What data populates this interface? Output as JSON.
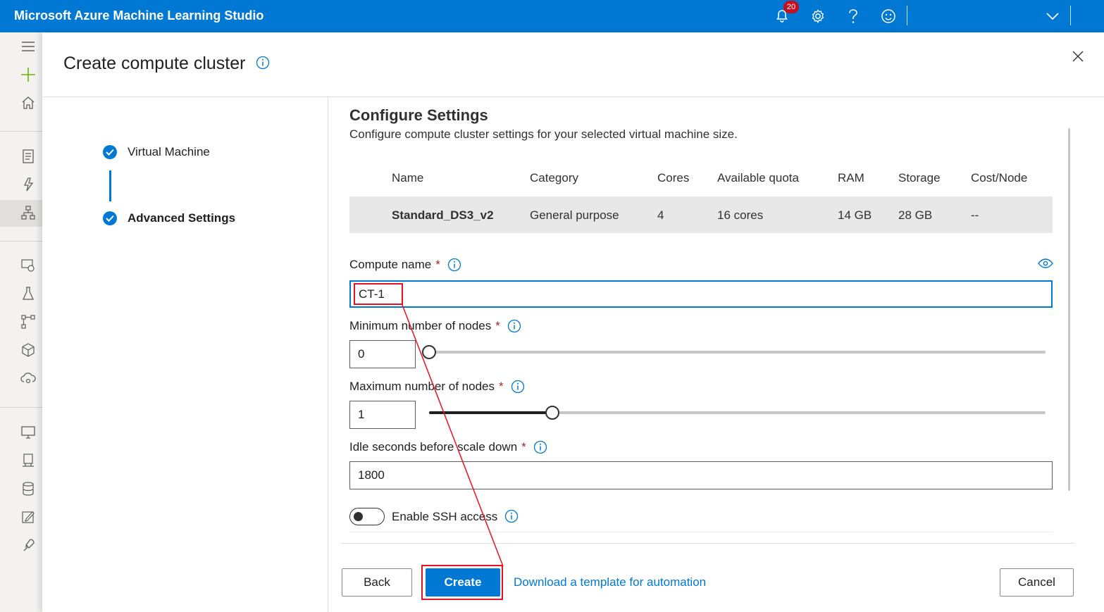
{
  "app": {
    "title": "Microsoft Azure Machine Learning Studio",
    "notification_count": "20"
  },
  "colors": {
    "brand": "#0078d4",
    "annotation": "#e81123"
  },
  "topbar_icons": [
    "bell-icon",
    "gear-icon",
    "help-icon",
    "smiley-icon",
    "chevron-down-icon"
  ],
  "leftnav_icons": [
    "hamburger-icon",
    "plus-icon",
    "home-icon",
    "notebook-icon",
    "automl-icon",
    "designer-icon",
    "datasets-icon",
    "experiments-icon",
    "pipelines-icon",
    "models-icon",
    "endpoints-icon",
    "compute-icon",
    "environments-icon",
    "datastores-icon",
    "labeling-icon",
    "linked-services-icon"
  ],
  "panel": {
    "title": "Create compute cluster"
  },
  "steps": [
    {
      "label": "Virtual Machine"
    },
    {
      "label": "Advanced Settings"
    }
  ],
  "section": {
    "title": "Configure Settings",
    "subtitle": "Configure compute cluster settings for your selected virtual machine size."
  },
  "vm_table": {
    "headers": [
      "Name",
      "Category",
      "Cores",
      "Available quota",
      "RAM",
      "Storage",
      "Cost/Node"
    ],
    "row": [
      "Standard_DS3_v2",
      "General purpose",
      "4",
      "16 cores",
      "14 GB",
      "28 GB",
      "--"
    ]
  },
  "fields": {
    "compute_name": {
      "label": "Compute name",
      "value": "CT-1"
    },
    "min_nodes": {
      "label": "Minimum number of nodes",
      "value": "0",
      "slider_fraction": 0.0
    },
    "max_nodes": {
      "label": "Maximum number of nodes",
      "value": "1",
      "slider_fraction": 0.2
    },
    "idle_seconds": {
      "label": "Idle seconds before scale down",
      "value": "1800"
    },
    "ssh": {
      "label": "Enable SSH access",
      "enabled": false
    }
  },
  "footer": {
    "back_label": "Back",
    "create_label": "Create",
    "template_link": "Download a template for automation",
    "cancel_label": "Cancel"
  }
}
